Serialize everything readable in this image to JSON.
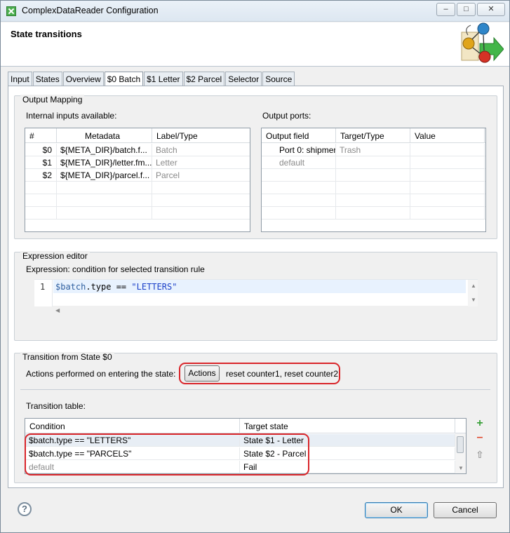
{
  "window": {
    "title": "ComplexDataReader Configuration",
    "minimize": "–",
    "maximize": "□",
    "close": "✕"
  },
  "header": {
    "title": "State transitions"
  },
  "tabs": [
    {
      "label": "Input"
    },
    {
      "label": "States"
    },
    {
      "label": "Overview"
    },
    {
      "label": "$0 Batch"
    },
    {
      "label": "$1 Letter"
    },
    {
      "label": "$2 Parcel"
    },
    {
      "label": "Selector"
    },
    {
      "label": "Source"
    }
  ],
  "output_mapping": {
    "title": "Output Mapping",
    "inputs_label": "Internal inputs available:",
    "ports_label": "Output ports:",
    "inputs_headers": [
      "#",
      "Metadata",
      "Label/Type"
    ],
    "inputs_rows": [
      {
        "num": "$0",
        "meta": "${META_DIR}/batch.f...",
        "type": "Batch"
      },
      {
        "num": "$1",
        "meta": "${META_DIR}/letter.fm...",
        "type": "Letter"
      },
      {
        "num": "$2",
        "meta": "${META_DIR}/parcel.f...",
        "type": "Parcel"
      }
    ],
    "ports_headers": [
      "Output field",
      "Target/Type",
      "Value"
    ],
    "ports_rows": [
      {
        "field": "Port 0: shipmer",
        "target": "Trash",
        "value": ""
      },
      {
        "field": "default",
        "target": "",
        "value": ""
      }
    ]
  },
  "expression": {
    "title": "Expression editor",
    "label": "Expression: condition for selected transition rule",
    "line_number": "1",
    "code_var": "$batch",
    "code_mid": ".type == ",
    "code_str": "\"LETTERS\""
  },
  "transition": {
    "title": "Transition from State $0",
    "actions_label": "Actions performed on entering the state:",
    "actions_button": "Actions",
    "actions_value": "reset counter1, reset counter2",
    "table_label": "Transition table:",
    "headers": [
      "Condition",
      "Target state"
    ],
    "rows": [
      {
        "condition": "$batch.type == \"LETTERS\"",
        "target": "State $1 - Letter"
      },
      {
        "condition": "$batch.type == \"PARCELS\"",
        "target": "State $2 - Parcel"
      },
      {
        "condition": "default",
        "target": "Fail"
      }
    ],
    "colors": {
      "highlight": "#d9252a",
      "add": "#3aa13a",
      "remove": "#e0462b"
    }
  },
  "footer": {
    "help": "?",
    "ok": "OK",
    "cancel": "Cancel"
  },
  "icons": [
    "app-icon",
    "state-transition-logo",
    "add-icon",
    "remove-icon",
    "move-up-icon",
    "help-icon"
  ]
}
